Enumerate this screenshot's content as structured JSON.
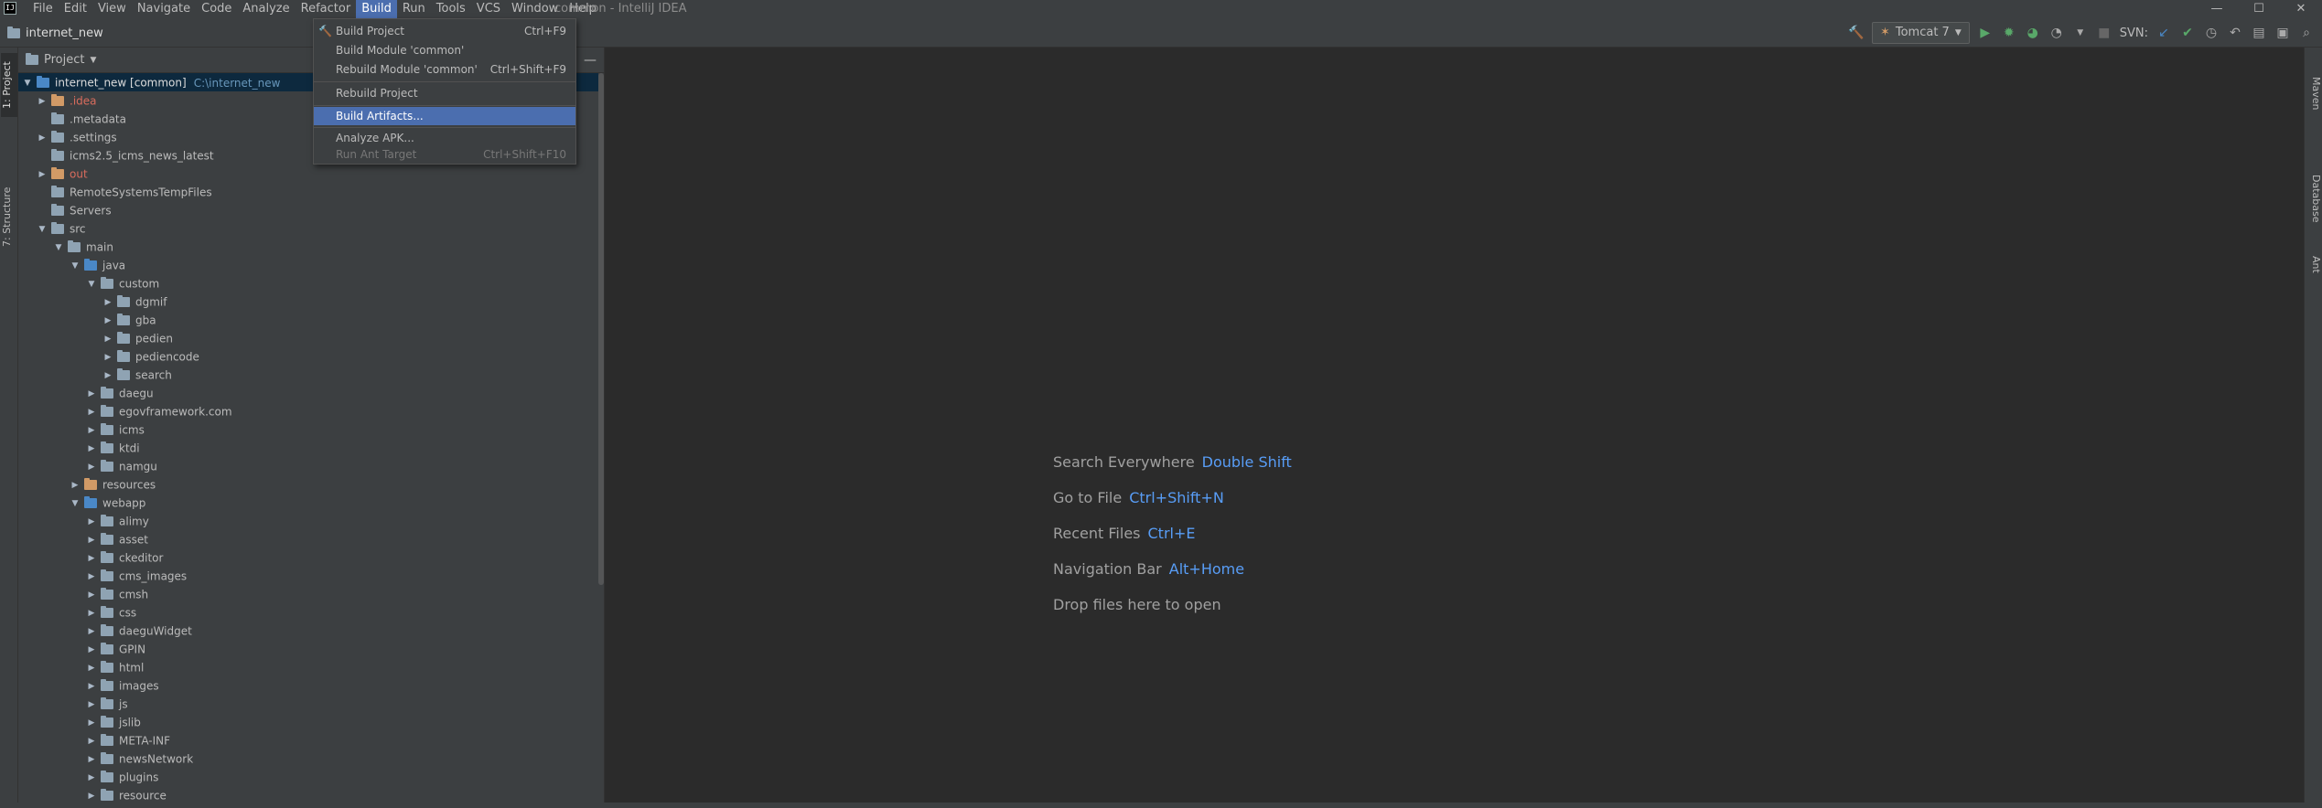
{
  "menubar": {
    "logo_text": "IJ",
    "items": [
      "File",
      "Edit",
      "View",
      "Navigate",
      "Code",
      "Analyze",
      "Refactor",
      "Build",
      "Run",
      "Tools",
      "VCS",
      "Window",
      "Help"
    ],
    "window_title": "common - IntelliJ IDEA",
    "minimize": "—",
    "maximize": "☐",
    "close": "✕"
  },
  "navbar": {
    "project": "internet_new",
    "run_config": "Tomcat 7",
    "svn_label": "SVN:"
  },
  "left_strip": {
    "project_tab": "1: Project",
    "structure_tab": "7: Structure"
  },
  "right_strip": {
    "maven": "Maven",
    "database": "Database",
    "ant": "Ant"
  },
  "project_panel": {
    "view_label": "Project",
    "collapse": "—",
    "tree": [
      {
        "label": "internet_new [common]",
        "hint": "C:\\internet_new",
        "arrow": "▼",
        "selected": true
      },
      {
        "label": ".idea",
        "arrow": "▶",
        "color": "red"
      },
      {
        "label": ".metadata",
        "arrow": ""
      },
      {
        "label": ".settings",
        "arrow": "▶"
      },
      {
        "label": "icms2.5_icms_news_latest",
        "arrow": ""
      },
      {
        "label": "out",
        "arrow": "▶",
        "color": "red"
      },
      {
        "label": "RemoteSystemsTempFiles",
        "arrow": ""
      },
      {
        "label": "Servers",
        "arrow": ""
      },
      {
        "label": "src",
        "arrow": "▼"
      },
      {
        "label": "main",
        "arrow": "▼"
      },
      {
        "label": "java",
        "arrow": "▼"
      },
      {
        "label": "custom",
        "arrow": "▼"
      },
      {
        "label": "dgmif",
        "arrow": "▶"
      },
      {
        "label": "gba",
        "arrow": "▶"
      },
      {
        "label": "pedien",
        "arrow": "▶"
      },
      {
        "label": "pediencode",
        "arrow": "▶"
      },
      {
        "label": "search",
        "arrow": "▶"
      },
      {
        "label": "daegu",
        "arrow": "▶"
      },
      {
        "label": "egovframework.com",
        "arrow": "▶"
      },
      {
        "label": "icms",
        "arrow": "▶"
      },
      {
        "label": "ktdi",
        "arrow": "▶"
      },
      {
        "label": "namgu",
        "arrow": "▶"
      },
      {
        "label": "resources",
        "arrow": "▶"
      },
      {
        "label": "webapp",
        "arrow": "▼"
      },
      {
        "label": "alimy",
        "arrow": "▶"
      },
      {
        "label": "asset",
        "arrow": "▶"
      },
      {
        "label": "ckeditor",
        "arrow": "▶"
      },
      {
        "label": "cms_images",
        "arrow": "▶"
      },
      {
        "label": "cmsh",
        "arrow": "▶"
      },
      {
        "label": "css",
        "arrow": "▶"
      },
      {
        "label": "daeguWidget",
        "arrow": "▶"
      },
      {
        "label": "GPIN",
        "arrow": "▶"
      },
      {
        "label": "html",
        "arrow": "▶"
      },
      {
        "label": "images",
        "arrow": "▶"
      },
      {
        "label": "js",
        "arrow": "▶"
      },
      {
        "label": "jslib",
        "arrow": "▶"
      },
      {
        "label": "META-INF",
        "arrow": "▶"
      },
      {
        "label": "newsNetwork",
        "arrow": "▶"
      },
      {
        "label": "plugins",
        "arrow": "▶"
      },
      {
        "label": "resource",
        "arrow": "▶"
      }
    ]
  },
  "editor": {
    "hints": [
      {
        "text": "Search Everywhere",
        "key": "Double Shift"
      },
      {
        "text": "Go to File",
        "key": "Ctrl+Shift+N"
      },
      {
        "text": "Recent Files",
        "key": "Ctrl+E"
      },
      {
        "text": "Navigation Bar",
        "key": "Alt+Home"
      },
      {
        "text": "Drop files here to open",
        "key": ""
      }
    ]
  },
  "build_menu": {
    "build_project": {
      "label": "Build Project",
      "shortcut": "Ctrl+F9"
    },
    "build_module": {
      "label": "Build Module 'common'",
      "shortcut": ""
    },
    "rebuild_module": {
      "label": "Rebuild Module 'common'",
      "shortcut": "Ctrl+Shift+F9"
    },
    "rebuild_project": {
      "label": "Rebuild Project",
      "shortcut": ""
    },
    "build_artifacts": {
      "label": "Build Artifacts...",
      "shortcut": ""
    },
    "analyze_apk": {
      "label": "Analyze APK...",
      "shortcut": ""
    },
    "run_ant_target": {
      "label": "Run Ant Target",
      "shortcut": "Ctrl+Shift+F10"
    }
  }
}
